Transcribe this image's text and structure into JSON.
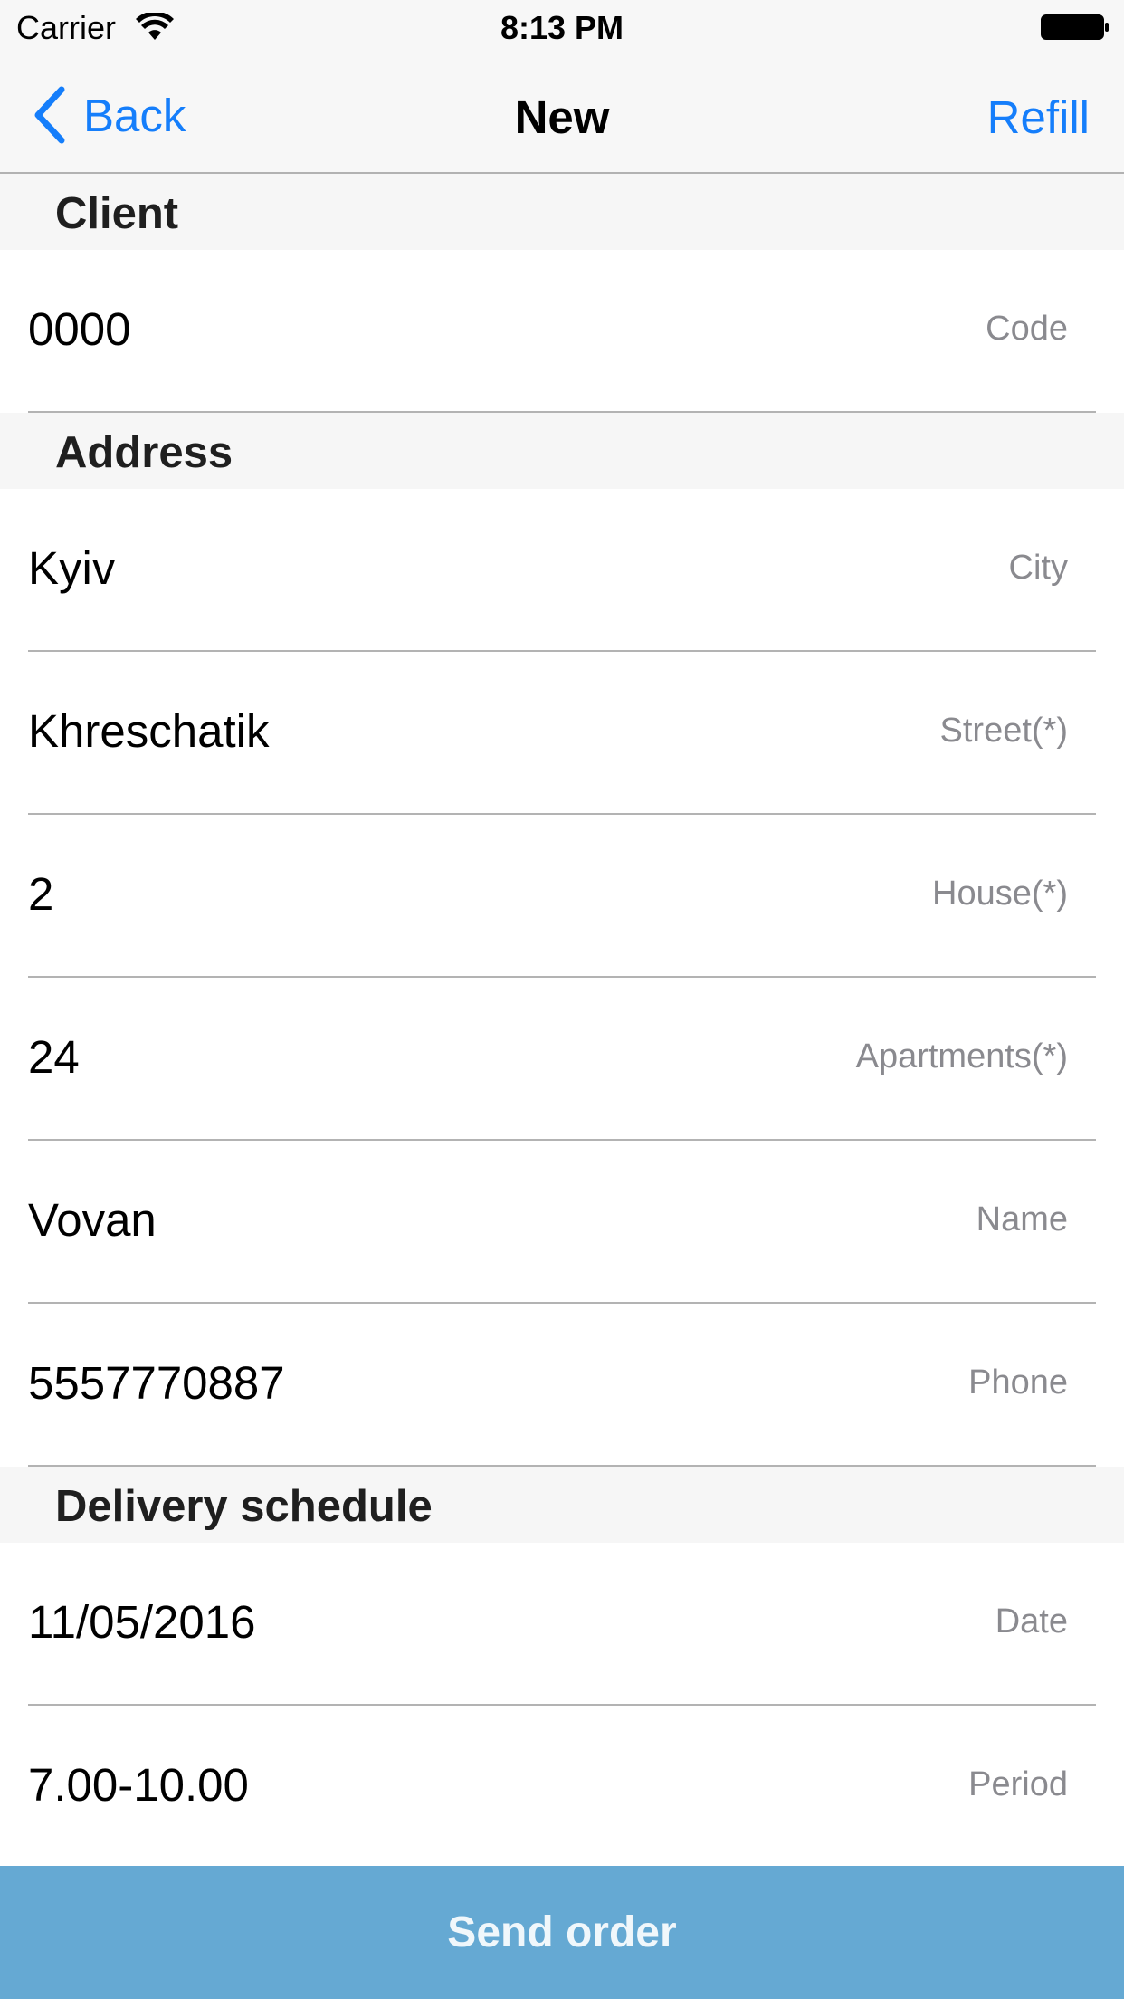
{
  "status_bar": {
    "carrier": "Carrier",
    "time": "8:13 PM"
  },
  "nav": {
    "back_label": "Back",
    "title": "New",
    "refill_label": "Refill",
    "accent_color": "#157efb"
  },
  "sections": {
    "client": "Client",
    "address": "Address",
    "delivery": "Delivery schedule"
  },
  "fields": {
    "code": {
      "value": "0000",
      "label": "Code"
    },
    "city": {
      "value": "Kyiv",
      "label": "City"
    },
    "street": {
      "value": "Khreschatik",
      "label": "Street(*)"
    },
    "house": {
      "value": "2",
      "label": "House(*)"
    },
    "apartments": {
      "value": "24",
      "label": "Apartments(*)"
    },
    "name": {
      "value": "Vovan",
      "label": "Name"
    },
    "phone": {
      "value": "5557770887",
      "label": "Phone"
    },
    "date": {
      "value": "11/05/2016",
      "label": "Date"
    },
    "period": {
      "value": "7.00-10.00",
      "label": "Period"
    }
  },
  "send_button": {
    "label": "Send order",
    "color": "#65a9d3"
  }
}
